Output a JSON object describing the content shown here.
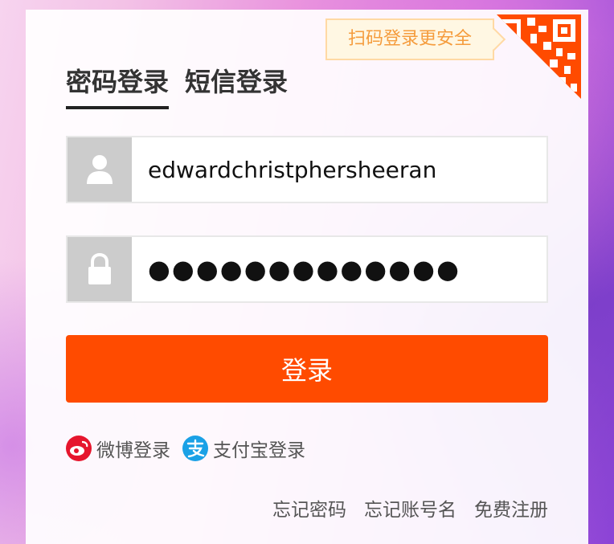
{
  "qr_login": {
    "tip": "扫码登录更安全",
    "icon": "qr-code-corner-icon",
    "color": "#ff4b00"
  },
  "tabs": [
    {
      "label": "密码登录",
      "active": true
    },
    {
      "label": "短信登录",
      "active": false
    }
  ],
  "form": {
    "username": {
      "value": "edwardchristphersheeran",
      "icon": "user-icon"
    },
    "password": {
      "masked_value": "●●●●●●●●●●●●●",
      "icon": "lock-icon"
    },
    "submit_label": "登录",
    "accent_color": "#ff4b00"
  },
  "social_login": [
    {
      "label": "微博登录",
      "icon": "weibo-icon",
      "color": "#e6162d"
    },
    {
      "label": "支付宝登录",
      "icon": "alipay-icon",
      "color": "#1aa1e6"
    }
  ],
  "footer_links": [
    "忘记密码",
    "忘记账号名",
    "免费注册"
  ]
}
